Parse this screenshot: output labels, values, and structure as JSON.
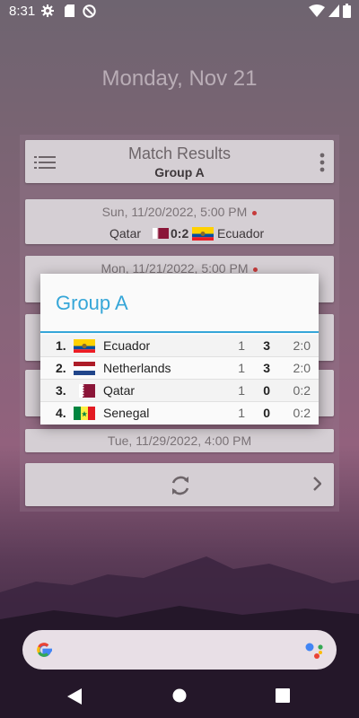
{
  "status_bar": {
    "time": "8:31"
  },
  "widget": {
    "date": "Monday, Nov 21",
    "header_title": "Match Results",
    "header_subtitle": "Group A",
    "matches": [
      {
        "datetime": "Sun, 11/20/2022, 5:00 PM",
        "home": "Qatar",
        "score": "0:2",
        "away": "Ecuador"
      },
      {
        "datetime": "Mon, 11/21/2022, 5:00 PM"
      },
      {
        "datetime": "Tue, 11/29/2022, 4:00 PM"
      }
    ]
  },
  "dialog": {
    "title": "Group A",
    "rows": [
      {
        "rank": "1.",
        "team": "Ecuador",
        "played": "1",
        "points": "3",
        "score": "2:0",
        "flag": "ecuador"
      },
      {
        "rank": "2.",
        "team": "Netherlands",
        "played": "1",
        "points": "3",
        "score": "2:0",
        "flag": "netherlands"
      },
      {
        "rank": "3.",
        "team": "Qatar",
        "played": "1",
        "points": "0",
        "score": "0:2",
        "flag": "qatar"
      },
      {
        "rank": "4.",
        "team": "Senegal",
        "played": "1",
        "points": "0",
        "score": "0:2",
        "flag": "senegal"
      }
    ]
  },
  "colors": {
    "accent": "#35a6d8",
    "live_dot": "#c63b3b"
  },
  "icons": [
    "gear-icon",
    "sd-card-icon",
    "vpn-key-icon",
    "wifi-icon",
    "battery-icon",
    "menu-icon",
    "more-vert-icon",
    "refresh-icon",
    "chevron-right-icon",
    "google-icon",
    "assistant-icon",
    "back-icon",
    "home-icon",
    "recents-icon"
  ]
}
